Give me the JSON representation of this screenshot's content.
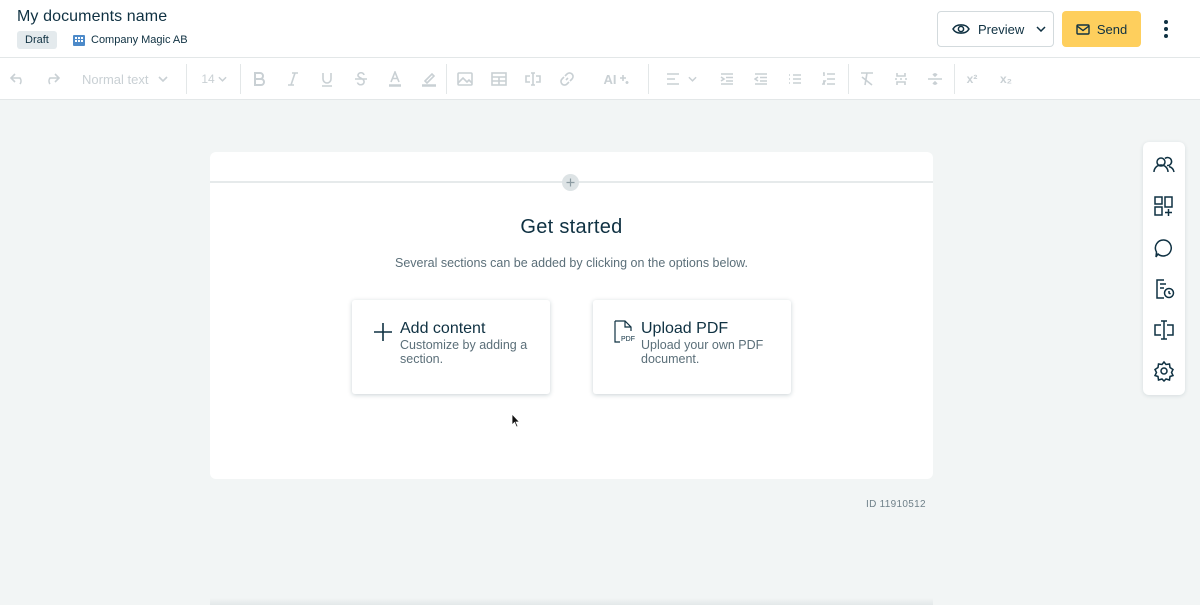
{
  "header": {
    "title": "My documents name",
    "status": "Draft",
    "company": "Company Magic AB",
    "preview_label": "Preview",
    "send_label": "Send"
  },
  "toolbar": {
    "text_style": "Normal text",
    "font_size": "14",
    "ai_label": "AI",
    "superscript_label": "x²",
    "subscript_label": "x₂"
  },
  "document": {
    "heading": "Get started",
    "subtitle": "Several sections can be added by clicking on the options below.",
    "options": [
      {
        "title": "Add content",
        "description": "Customize by adding a section.",
        "icon": "plus-icon"
      },
      {
        "title": "Upload PDF",
        "description": "Upload your own PDF document.",
        "icon": "pdf-file-icon"
      }
    ],
    "id_label": "ID 11910512"
  },
  "side_panel": {
    "icons": [
      "recipients-icon",
      "add-block-icon",
      "comments-icon",
      "history-icon",
      "variables-icon",
      "settings-icon"
    ]
  },
  "colors": {
    "brand_text": "#0f3142",
    "send_button": "#fecf5d",
    "background": "#f2f5f5"
  }
}
